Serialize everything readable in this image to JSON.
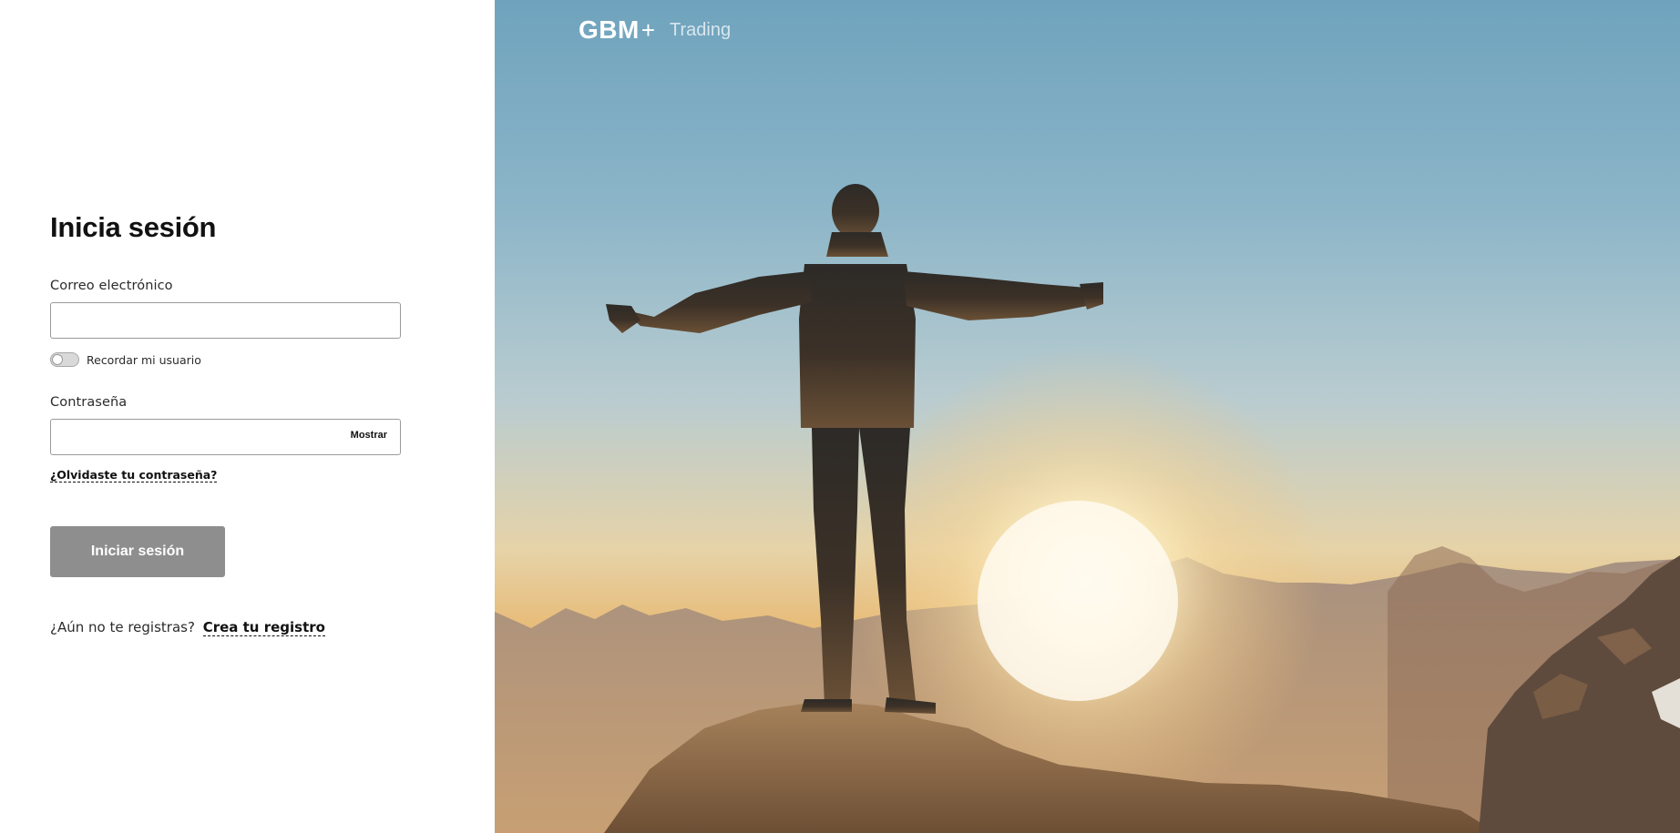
{
  "login": {
    "title": "Inicia sesión",
    "email_label": "Correo electrónico",
    "email_value": "",
    "remember_label": "Recordar mi usuario",
    "remember_on": false,
    "password_label": "Contraseña",
    "password_value": "",
    "show_label": "Mostrar",
    "forgot_label": "¿Olvidaste tu contraseña?",
    "submit_label": "Iniciar sesión",
    "register_prompt": "¿Aún no te registras?",
    "register_link": "Crea tu registro"
  },
  "brand": {
    "logo_text": "GBM",
    "plus": "+",
    "product": "Trading"
  },
  "colors": {
    "submit_disabled": "#8e8e8e",
    "sky_top": "#6fa3bd",
    "sun_glow": "#fff6dc",
    "rock_dark": "#5e4b3e"
  },
  "icons": {
    "hero_image": "person-on-mountain-sunrise-illustration"
  }
}
